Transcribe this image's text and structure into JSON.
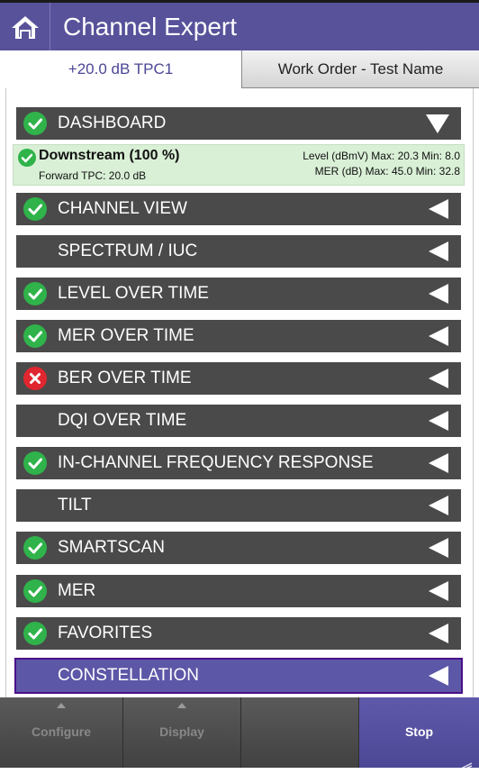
{
  "header": {
    "title": "Channel Expert",
    "home_icon": "home-icon"
  },
  "tabs": {
    "left_label": "+20.0 dB TPC1",
    "right_label": "Work Order - Test Name"
  },
  "colors": {
    "header_bg": "#57529a",
    "row_bg": "#4a4a4a",
    "selected_row_bg": "#5d57a7",
    "pass_green": "#2fb34a",
    "fail_red": "#e0262f",
    "summary_bg": "#d9f0d6"
  },
  "dashboard": {
    "label": "DASHBOARD",
    "status": "pass",
    "expanded": true,
    "summary": {
      "title": "Downstream (100 %)",
      "forward_tpc": "Forward TPC: 20.0 dB",
      "level": "Level (dBmV) Max: 20.3  Min: 8.0",
      "mer": "MER (dB) Max: 45.0  Min: 32.8"
    }
  },
  "items": [
    {
      "label": "CHANNEL VIEW",
      "status": "pass"
    },
    {
      "label": "SPECTRUM / IUC",
      "status": "none"
    },
    {
      "label": "LEVEL OVER TIME",
      "status": "pass"
    },
    {
      "label": "MER OVER TIME",
      "status": "pass"
    },
    {
      "label": "BER OVER TIME",
      "status": "fail"
    },
    {
      "label": "DQI OVER TIME",
      "status": "none"
    },
    {
      "label": "IN-CHANNEL FREQUENCY RESPONSE",
      "status": "pass"
    },
    {
      "label": "TILT",
      "status": "none"
    },
    {
      "label": "SMARTSCAN",
      "status": "pass"
    },
    {
      "label": "MER",
      "status": "pass"
    },
    {
      "label": "FAVORITES",
      "status": "pass"
    },
    {
      "label": "CONSTELLATION",
      "status": "none",
      "selected": true
    }
  ],
  "bottom": {
    "configure": "Configure",
    "display": "Display",
    "stop": "Stop"
  }
}
